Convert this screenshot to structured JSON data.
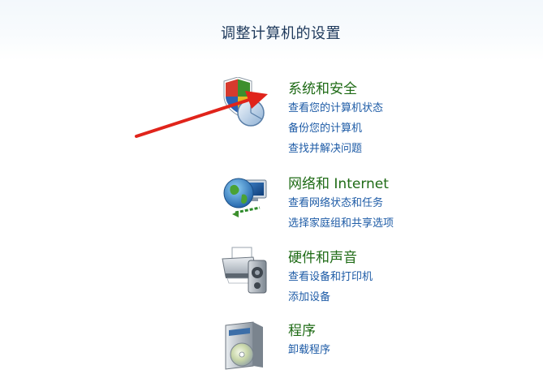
{
  "page": {
    "title": "调整计算机的设置"
  },
  "categories": [
    {
      "title": "系统和安全",
      "icon": "shield-chart-icon",
      "links": [
        "查看您的计算机状态",
        "备份您的计算机",
        "查找并解决问题"
      ]
    },
    {
      "title": "网络和 Internet",
      "icon": "network-globe-icon",
      "links": [
        "查看网络状态和任务",
        "选择家庭组和共享选项"
      ]
    },
    {
      "title": "硬件和声音",
      "icon": "printer-speaker-icon",
      "links": [
        "查看设备和打印机",
        "添加设备"
      ]
    },
    {
      "title": "程序",
      "icon": "programs-disc-icon",
      "links": [
        "卸载程序"
      ]
    }
  ],
  "annotation": {
    "arrow_color": "#e0241b"
  },
  "colors": {
    "category_title": "#1f6b16",
    "link": "#1d5ba6",
    "page_title": "#1e395b"
  }
}
